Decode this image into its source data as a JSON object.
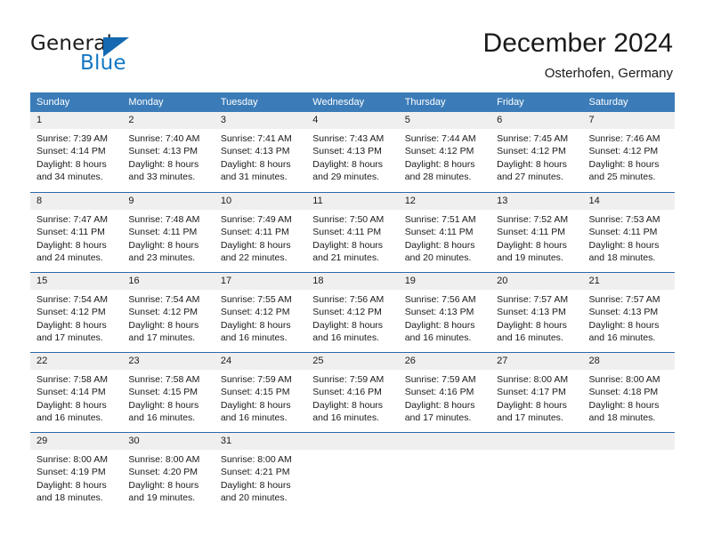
{
  "brand": {
    "name_top": "General",
    "name_bottom": "Blue",
    "flag_icon": "triangle-flag-icon",
    "color_top": "#1c1c1c",
    "color_bottom": "#1277c4",
    "flag_color": "#1469b0"
  },
  "header": {
    "title": "December 2024",
    "subtitle": "Osterhofen, Germany"
  },
  "theme": {
    "header_row_bg": "#3b7cb8",
    "header_row_text": "#ffffff",
    "daynum_band_bg": "#efefef",
    "week_divider": "#2b6aa8",
    "body_text": "#1a1a1a"
  },
  "weekdays": [
    "Sunday",
    "Monday",
    "Tuesday",
    "Wednesday",
    "Thursday",
    "Friday",
    "Saturday"
  ],
  "weeks": [
    [
      {
        "day": "1",
        "sunrise": "Sunrise: 7:39 AM",
        "sunset": "Sunset: 4:14 PM",
        "daylight1": "Daylight: 8 hours",
        "daylight2": "and 34 minutes."
      },
      {
        "day": "2",
        "sunrise": "Sunrise: 7:40 AM",
        "sunset": "Sunset: 4:13 PM",
        "daylight1": "Daylight: 8 hours",
        "daylight2": "and 33 minutes."
      },
      {
        "day": "3",
        "sunrise": "Sunrise: 7:41 AM",
        "sunset": "Sunset: 4:13 PM",
        "daylight1": "Daylight: 8 hours",
        "daylight2": "and 31 minutes."
      },
      {
        "day": "4",
        "sunrise": "Sunrise: 7:43 AM",
        "sunset": "Sunset: 4:13 PM",
        "daylight1": "Daylight: 8 hours",
        "daylight2": "and 29 minutes."
      },
      {
        "day": "5",
        "sunrise": "Sunrise: 7:44 AM",
        "sunset": "Sunset: 4:12 PM",
        "daylight1": "Daylight: 8 hours",
        "daylight2": "and 28 minutes."
      },
      {
        "day": "6",
        "sunrise": "Sunrise: 7:45 AM",
        "sunset": "Sunset: 4:12 PM",
        "daylight1": "Daylight: 8 hours",
        "daylight2": "and 27 minutes."
      },
      {
        "day": "7",
        "sunrise": "Sunrise: 7:46 AM",
        "sunset": "Sunset: 4:12 PM",
        "daylight1": "Daylight: 8 hours",
        "daylight2": "and 25 minutes."
      }
    ],
    [
      {
        "day": "8",
        "sunrise": "Sunrise: 7:47 AM",
        "sunset": "Sunset: 4:11 PM",
        "daylight1": "Daylight: 8 hours",
        "daylight2": "and 24 minutes."
      },
      {
        "day": "9",
        "sunrise": "Sunrise: 7:48 AM",
        "sunset": "Sunset: 4:11 PM",
        "daylight1": "Daylight: 8 hours",
        "daylight2": "and 23 minutes."
      },
      {
        "day": "10",
        "sunrise": "Sunrise: 7:49 AM",
        "sunset": "Sunset: 4:11 PM",
        "daylight1": "Daylight: 8 hours",
        "daylight2": "and 22 minutes."
      },
      {
        "day": "11",
        "sunrise": "Sunrise: 7:50 AM",
        "sunset": "Sunset: 4:11 PM",
        "daylight1": "Daylight: 8 hours",
        "daylight2": "and 21 minutes."
      },
      {
        "day": "12",
        "sunrise": "Sunrise: 7:51 AM",
        "sunset": "Sunset: 4:11 PM",
        "daylight1": "Daylight: 8 hours",
        "daylight2": "and 20 minutes."
      },
      {
        "day": "13",
        "sunrise": "Sunrise: 7:52 AM",
        "sunset": "Sunset: 4:11 PM",
        "daylight1": "Daylight: 8 hours",
        "daylight2": "and 19 minutes."
      },
      {
        "day": "14",
        "sunrise": "Sunrise: 7:53 AM",
        "sunset": "Sunset: 4:11 PM",
        "daylight1": "Daylight: 8 hours",
        "daylight2": "and 18 minutes."
      }
    ],
    [
      {
        "day": "15",
        "sunrise": "Sunrise: 7:54 AM",
        "sunset": "Sunset: 4:12 PM",
        "daylight1": "Daylight: 8 hours",
        "daylight2": "and 17 minutes."
      },
      {
        "day": "16",
        "sunrise": "Sunrise: 7:54 AM",
        "sunset": "Sunset: 4:12 PM",
        "daylight1": "Daylight: 8 hours",
        "daylight2": "and 17 minutes."
      },
      {
        "day": "17",
        "sunrise": "Sunrise: 7:55 AM",
        "sunset": "Sunset: 4:12 PM",
        "daylight1": "Daylight: 8 hours",
        "daylight2": "and 16 minutes."
      },
      {
        "day": "18",
        "sunrise": "Sunrise: 7:56 AM",
        "sunset": "Sunset: 4:12 PM",
        "daylight1": "Daylight: 8 hours",
        "daylight2": "and 16 minutes."
      },
      {
        "day": "19",
        "sunrise": "Sunrise: 7:56 AM",
        "sunset": "Sunset: 4:13 PM",
        "daylight1": "Daylight: 8 hours",
        "daylight2": "and 16 minutes."
      },
      {
        "day": "20",
        "sunrise": "Sunrise: 7:57 AM",
        "sunset": "Sunset: 4:13 PM",
        "daylight1": "Daylight: 8 hours",
        "daylight2": "and 16 minutes."
      },
      {
        "day": "21",
        "sunrise": "Sunrise: 7:57 AM",
        "sunset": "Sunset: 4:13 PM",
        "daylight1": "Daylight: 8 hours",
        "daylight2": "and 16 minutes."
      }
    ],
    [
      {
        "day": "22",
        "sunrise": "Sunrise: 7:58 AM",
        "sunset": "Sunset: 4:14 PM",
        "daylight1": "Daylight: 8 hours",
        "daylight2": "and 16 minutes."
      },
      {
        "day": "23",
        "sunrise": "Sunrise: 7:58 AM",
        "sunset": "Sunset: 4:15 PM",
        "daylight1": "Daylight: 8 hours",
        "daylight2": "and 16 minutes."
      },
      {
        "day": "24",
        "sunrise": "Sunrise: 7:59 AM",
        "sunset": "Sunset: 4:15 PM",
        "daylight1": "Daylight: 8 hours",
        "daylight2": "and 16 minutes."
      },
      {
        "day": "25",
        "sunrise": "Sunrise: 7:59 AM",
        "sunset": "Sunset: 4:16 PM",
        "daylight1": "Daylight: 8 hours",
        "daylight2": "and 16 minutes."
      },
      {
        "day": "26",
        "sunrise": "Sunrise: 7:59 AM",
        "sunset": "Sunset: 4:16 PM",
        "daylight1": "Daylight: 8 hours",
        "daylight2": "and 17 minutes."
      },
      {
        "day": "27",
        "sunrise": "Sunrise: 8:00 AM",
        "sunset": "Sunset: 4:17 PM",
        "daylight1": "Daylight: 8 hours",
        "daylight2": "and 17 minutes."
      },
      {
        "day": "28",
        "sunrise": "Sunrise: 8:00 AM",
        "sunset": "Sunset: 4:18 PM",
        "daylight1": "Daylight: 8 hours",
        "daylight2": "and 18 minutes."
      }
    ],
    [
      {
        "day": "29",
        "sunrise": "Sunrise: 8:00 AM",
        "sunset": "Sunset: 4:19 PM",
        "daylight1": "Daylight: 8 hours",
        "daylight2": "and 18 minutes."
      },
      {
        "day": "30",
        "sunrise": "Sunrise: 8:00 AM",
        "sunset": "Sunset: 4:20 PM",
        "daylight1": "Daylight: 8 hours",
        "daylight2": "and 19 minutes."
      },
      {
        "day": "31",
        "sunrise": "Sunrise: 8:00 AM",
        "sunset": "Sunset: 4:21 PM",
        "daylight1": "Daylight: 8 hours",
        "daylight2": "and 20 minutes."
      },
      {
        "day": "",
        "sunrise": "",
        "sunset": "",
        "daylight1": "",
        "daylight2": ""
      },
      {
        "day": "",
        "sunrise": "",
        "sunset": "",
        "daylight1": "",
        "daylight2": ""
      },
      {
        "day": "",
        "sunrise": "",
        "sunset": "",
        "daylight1": "",
        "daylight2": ""
      },
      {
        "day": "",
        "sunrise": "",
        "sunset": "",
        "daylight1": "",
        "daylight2": ""
      }
    ]
  ]
}
